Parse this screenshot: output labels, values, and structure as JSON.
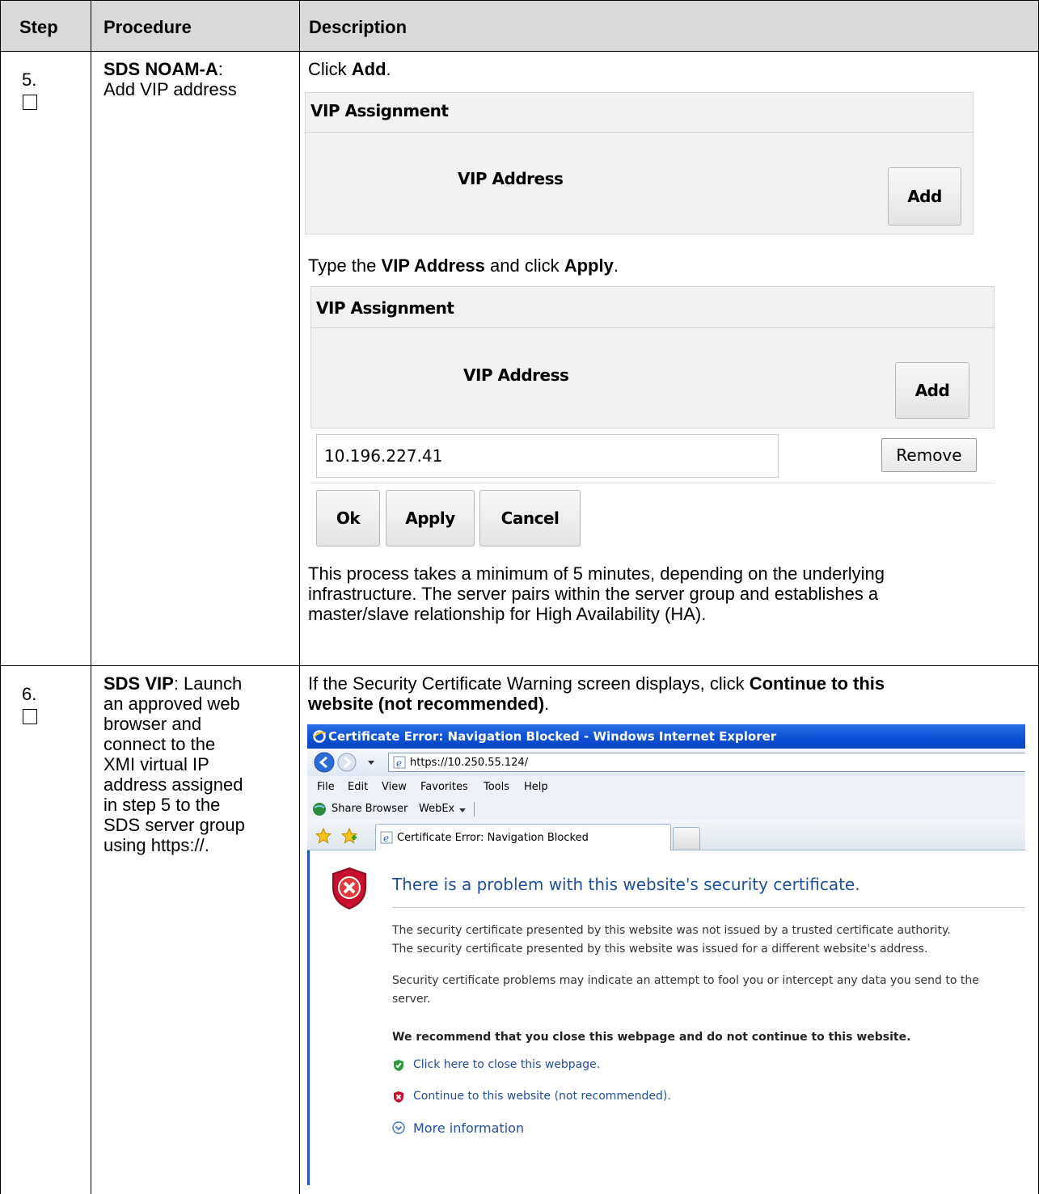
{
  "table": {
    "headers": [
      "Step",
      "Procedure",
      "Description"
    ],
    "rows": [
      {
        "step": "5.",
        "procedure_bold": "SDS NOAM-A",
        "procedure_rest": ":",
        "procedure_line2": "Add VIP address",
        "desc": {
          "click_prefix": "Click ",
          "click_bold": "Add",
          "click_suffix": ".",
          "panel1": {
            "title": "VIP Assignment",
            "label": "VIP Address",
            "add": "Add"
          },
          "type_prefix": "Type the ",
          "type_bold1": "VIP Address",
          "type_mid": " and click ",
          "type_bold2": "Apply",
          "type_suffix": ".",
          "panel2": {
            "title": "VIP Assignment",
            "label": "VIP Address",
            "add": "Add",
            "ip_value": "10.196.227.41",
            "remove": "Remove",
            "ok": "Ok",
            "apply": "Apply",
            "cancel": "Cancel"
          },
          "note_line1": "This process takes a minimum of 5 minutes, depending on the underlying",
          "note_line2": "infrastructure.  The server pairs within the server group and establishes a",
          "note_line3": "master/slave relationship for High Availability (HA)."
        }
      },
      {
        "step": "6.",
        "procedure_bold": "SDS VIP",
        "procedure_lines": [
          ":  Launch",
          "an approved web",
          "browser and",
          "connect to the",
          "XMI virtual IP",
          "address assigned",
          "in step 5 to the",
          "SDS server group",
          "using https://."
        ],
        "desc": {
          "line1_prefix": "If the Security Certificate Warning screen displays, click ",
          "line1_bold": "Continue to this",
          "line2_bold": "website (not recommended)",
          "line2_suffix": "."
        }
      }
    ]
  },
  "browser": {
    "title": "Certificate Error: Navigation Blocked - Windows Internet Explorer",
    "url": "https://10.250.55.124/",
    "menu": [
      "File",
      "Edit",
      "View",
      "Favorites",
      "Tools",
      "Help"
    ],
    "links": [
      "Share Browser",
      "WebEx"
    ],
    "tab_label": "Certificate Error: Navigation Blocked",
    "heading": "There is a problem with this website's security certificate.",
    "p1_line1": "The security certificate presented by this website was not issued by a trusted certificate authority.",
    "p1_line2": "The security certificate presented by this website was issued for a different website's address.",
    "p2_line1": "Security certificate problems may indicate an attempt to fool you or intercept any data you send to the",
    "p2_line2": "server.",
    "recommend": "We recommend that you close this webpage and do not continue to this website.",
    "close_link": "Click here to close this webpage.",
    "continue_link": "Continue to this website (not recommended).",
    "more_info": "More information",
    "colors": {
      "title_bar": "#0a4fd2",
      "link": "#1f4e9a",
      "error_red": "#c8102e"
    }
  }
}
